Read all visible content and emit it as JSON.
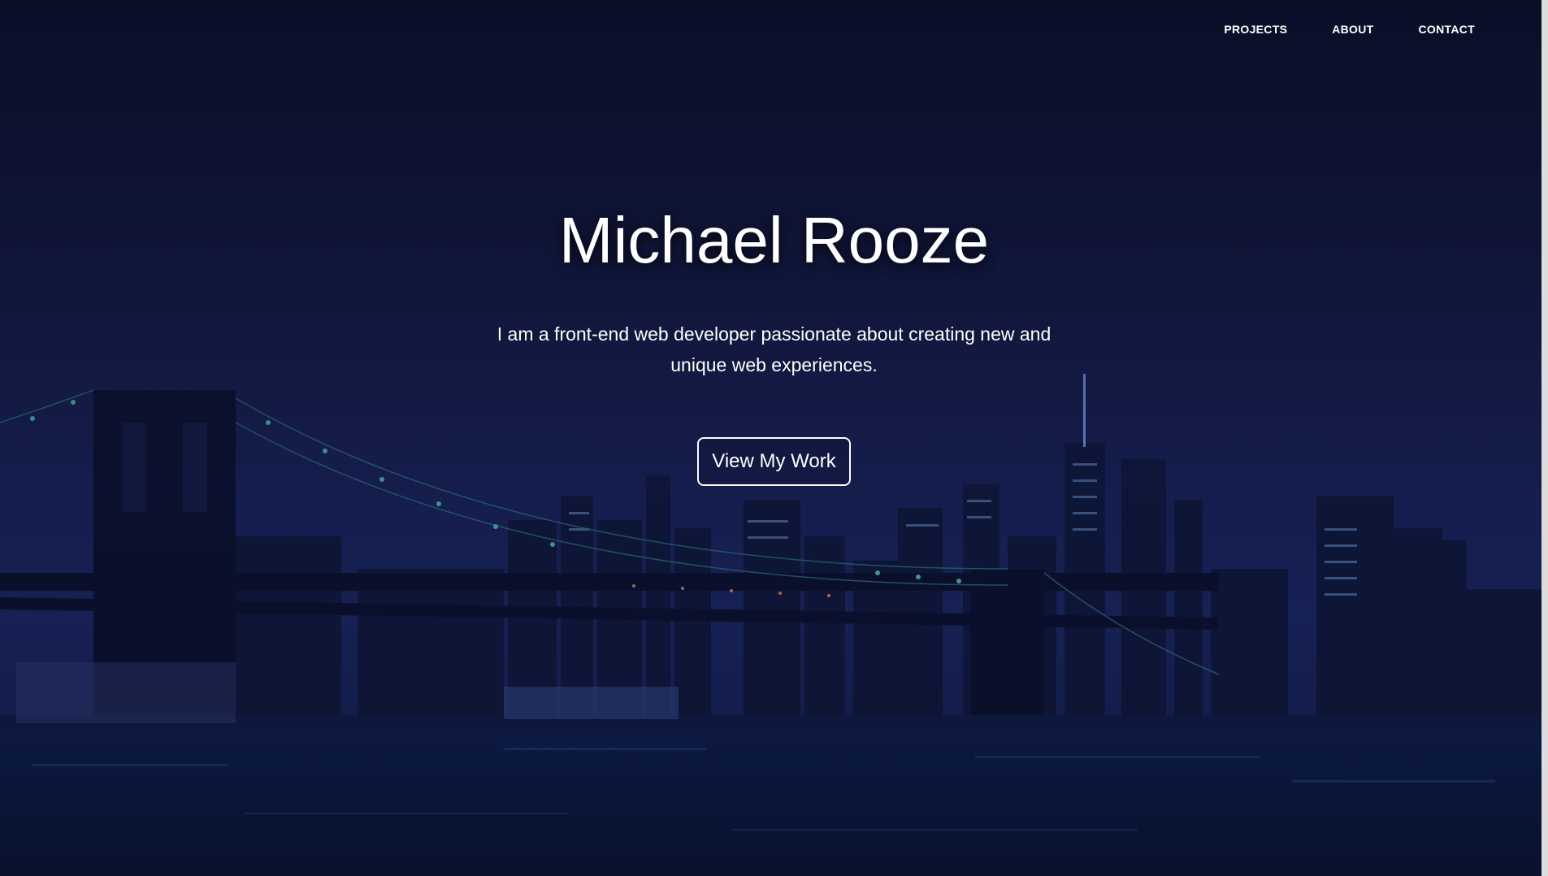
{
  "nav": {
    "items": [
      {
        "label": "PROJECTS"
      },
      {
        "label": "ABOUT"
      },
      {
        "label": "CONTACT"
      }
    ]
  },
  "hero": {
    "title": "Michael Rooze",
    "tagline": "I am a front-end web developer passionate about creating new and unique web experiences.",
    "cta_label": "View My Work"
  },
  "colors": {
    "sky": "#0b1230",
    "water": "#0a1a3a",
    "city_lights": "#9fd8ff",
    "text": "#ffffff"
  }
}
